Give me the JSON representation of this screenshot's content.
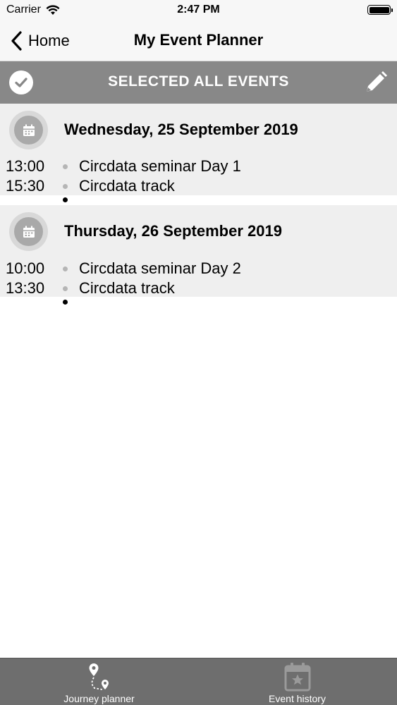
{
  "status_bar": {
    "carrier": "Carrier",
    "time": "2:47 PM",
    "icons": [
      "wifi-icon",
      "battery-icon"
    ]
  },
  "nav": {
    "back_label": "Home",
    "title": "My Event Planner"
  },
  "action_bar": {
    "title": "SELECTED ALL EVENTS",
    "left_icon": "checkmark-icon",
    "right_icon": "pencil-icon"
  },
  "days": [
    {
      "title": "Wednesday, 25 September 2019",
      "icon": "calendar-icon",
      "events": [
        {
          "time": "13:00",
          "name": "Circdata seminar Day 1"
        },
        {
          "time": "15:30",
          "name": "Circdata track"
        }
      ]
    },
    {
      "title": "Thursday, 26 September 2019",
      "icon": "calendar-icon",
      "events": [
        {
          "time": "10:00",
          "name": "Circdata seminar Day 2"
        },
        {
          "time": "13:30",
          "name": "Circdata track"
        }
      ]
    }
  ],
  "tabs": [
    {
      "label": "Journey planner",
      "icon": "route-pin-icon"
    },
    {
      "label": "Event history",
      "icon": "calendar-star-icon"
    }
  ],
  "colors": {
    "action_bar_bg": "#888888",
    "day_bg": "#efefef",
    "tab_bar_bg": "#6e6e6e",
    "nav_bg": "#f7f7f7"
  }
}
